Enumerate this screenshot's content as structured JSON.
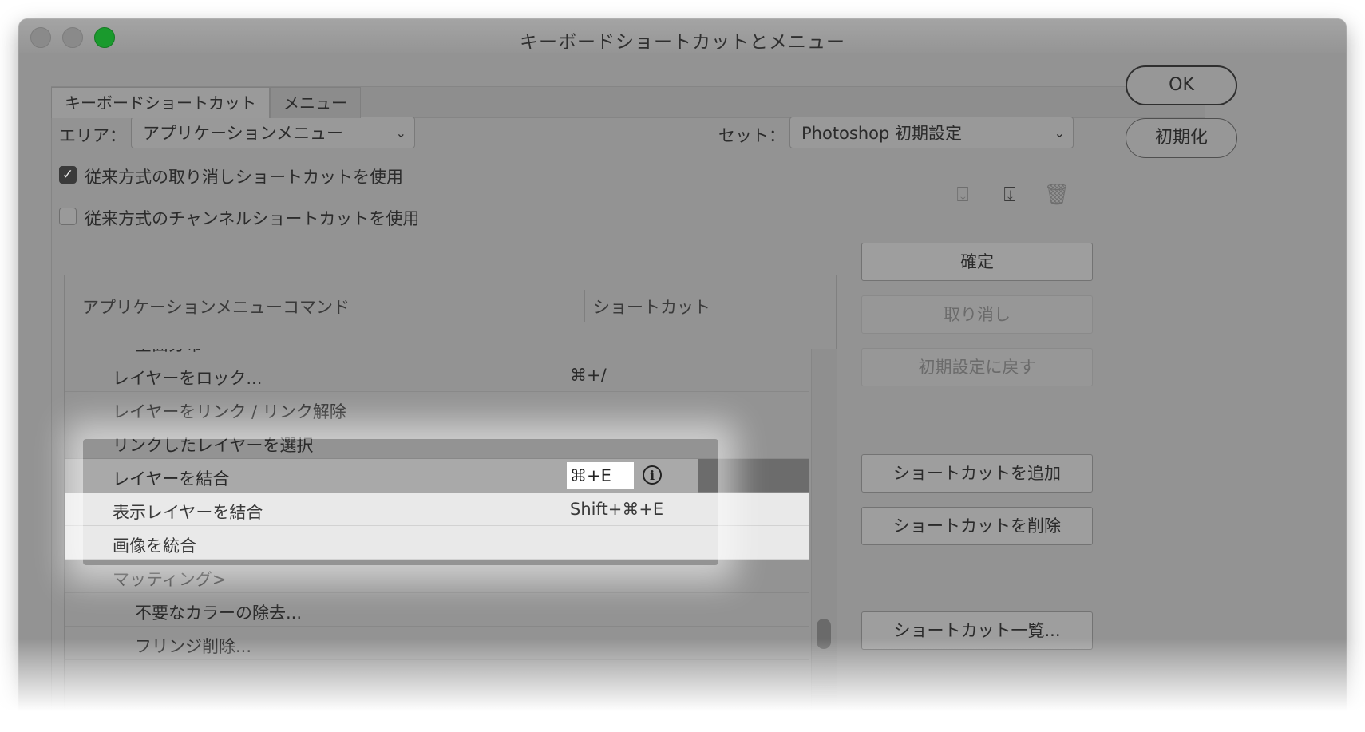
{
  "window": {
    "title": "キーボードショートカットとメニュー"
  },
  "tabs": [
    {
      "label": "キーボードショートカット"
    },
    {
      "label": "メニュー"
    }
  ],
  "area": {
    "label": "エリア：",
    "value": "アプリケーションメニュー"
  },
  "set": {
    "label": "セット：",
    "value": "Photoshop 初期設定"
  },
  "options": {
    "legacy_undo": {
      "label": "従来方式の取り消しショートカットを使用",
      "checked": true
    },
    "legacy_channel": {
      "label": "従来方式のチャンネルショートカットを使用",
      "checked": false
    }
  },
  "table": {
    "col_command": "アプリケーションメニューコマンド",
    "col_shortcut": "ショートカット",
    "rows": [
      {
        "name": "全面分布",
        "shortcut": "",
        "indent": 2
      },
      {
        "name": "レイヤーをロック...",
        "shortcut": "⌘+/",
        "indent": 1
      },
      {
        "name": "レイヤーをリンク / リンク解除",
        "shortcut": "",
        "indent": 1
      },
      {
        "name": "リンクしたレイヤーを選択",
        "shortcut": "",
        "indent": 1
      },
      {
        "name": "レイヤーを結合",
        "shortcut": "⌘+E",
        "indent": 1,
        "selected": true
      },
      {
        "name": "表示レイヤーを結合",
        "shortcut": "Shift+⌘+E",
        "indent": 1,
        "highlighted": true
      },
      {
        "name": "画像を統合",
        "shortcut": "",
        "indent": 1,
        "highlighted": true
      },
      {
        "name": "マッティング>",
        "shortcut": "",
        "indent": 1
      },
      {
        "name": "不要なカラーの除去...",
        "shortcut": "",
        "indent": 2
      },
      {
        "name": "フリンジ削除...",
        "shortcut": "",
        "indent": 2
      }
    ],
    "info_icon": "ⓘ"
  },
  "side_buttons": {
    "confirm": "確定",
    "undo": "取り消し",
    "reset_default": "初期設定に戻す",
    "add_shortcut": "ショートカットを追加",
    "delete_shortcut": "ショートカットを削除",
    "summarize": "ショートカット一覧..."
  },
  "dialog_buttons": {
    "ok": "OK",
    "reset": "初期化"
  },
  "icons": {
    "save": "save-set-icon",
    "save_as": "save-as-set-icon",
    "delete": "trash-icon"
  }
}
